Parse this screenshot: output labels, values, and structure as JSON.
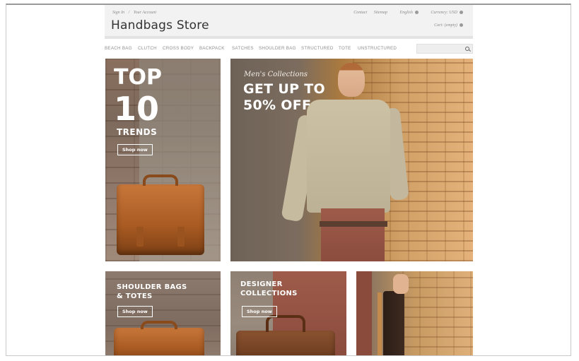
{
  "header": {
    "sign_in": "Sign In",
    "separator": "/",
    "your_account": "Your Account",
    "contact": "Contact",
    "sitemap": "Sitemap",
    "language": "English",
    "currency": "Currency: USD",
    "logo": "Handbags Store",
    "cart": "Cart: (empty)"
  },
  "nav": {
    "items": [
      "BEACH BAG",
      "CLUTCH",
      "CROSS BODY",
      "BACKPACK",
      "SATCHES",
      "SHOULDER BAG",
      "STRUCTURED",
      "TOTE",
      "UNSTRUCTURED"
    ],
    "search_placeholder": ""
  },
  "banners": {
    "top10": {
      "line1": "TOP",
      "line2": "10",
      "line3": "TRENDS",
      "button": "Shop now"
    },
    "mens": {
      "kicker": "Men's Collections",
      "line1": "GET UP TO",
      "line2": "50% OFF"
    },
    "shoulder": {
      "line1": "SHOULDER BAGS",
      "line2": "& TOTES",
      "button": "Shop now"
    },
    "designer": {
      "line1": "DESIGNER",
      "line2": "COLLECTIONS",
      "button": "Shop now"
    }
  },
  "icons": [
    "settings-dot-icon",
    "search-icon"
  ],
  "colors": {
    "topbar_bg": "#f2f2f2",
    "nav_text": "#8e8e8e",
    "logo_text": "#333333"
  }
}
